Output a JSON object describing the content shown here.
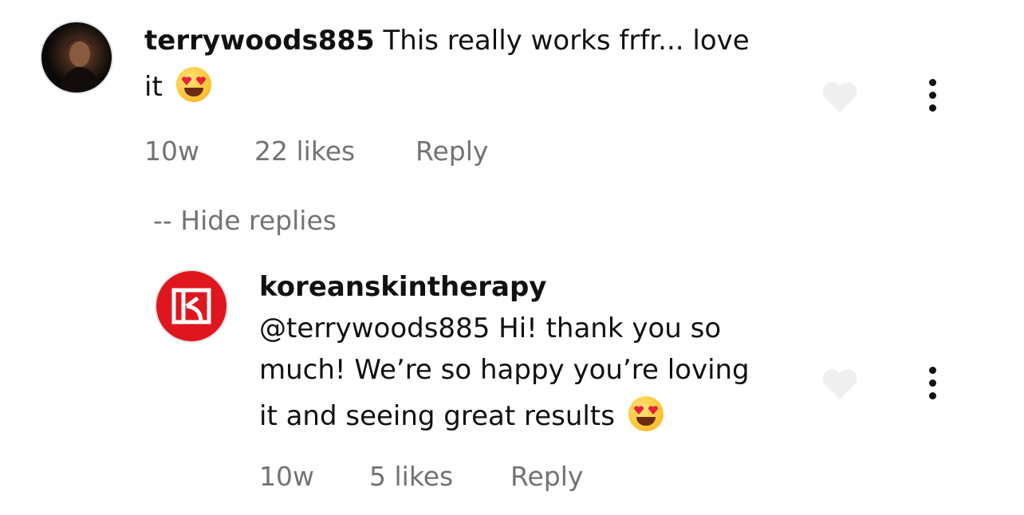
{
  "comment": {
    "username": "terrywoods885",
    "text_line1": "This really works frfr... love",
    "text_line2": "it",
    "emoji": "heart-eyes-emoji",
    "time": "10w",
    "likes": "22 likes",
    "reply_label": "Reply",
    "avatar_icon": "user-photo-avatar"
  },
  "hide_replies_label": "-- Hide replies",
  "reply": {
    "username": "koreanskintherapy",
    "text_line1": "@terrywoods885 Hi! thank you so",
    "text_line2": "much! We’re so happy you’re loving",
    "text_line3": "it and seeing great results",
    "emoji": "heart-eyes-emoji",
    "time": "10w",
    "likes": "5 likes",
    "reply_label": "Reply",
    "avatar_icon": "brand-logo-avatar",
    "avatar_color": "#e0161f"
  },
  "colors": {
    "meta": "#737373",
    "heart_fill": "#efefef"
  }
}
